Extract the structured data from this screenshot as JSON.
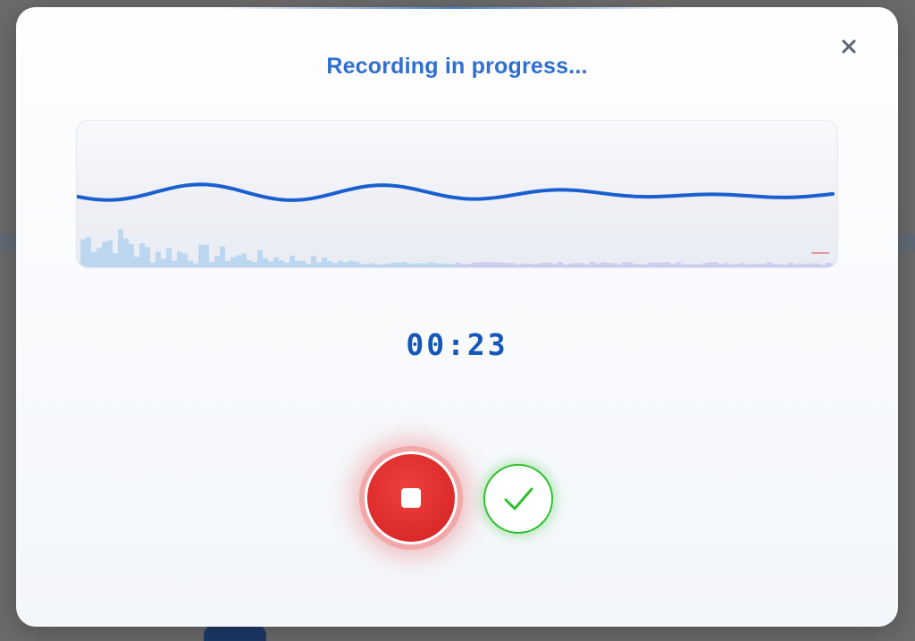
{
  "dialog": {
    "title": "Recording in progress...",
    "timer": "00:23"
  },
  "controls": {
    "close_icon": "close-icon",
    "stop_icon": "stop-icon",
    "confirm_icon": "checkmark-icon"
  },
  "colors": {
    "accent": "#2f6fd0",
    "timer": "#1557b8",
    "waveform": "#1a5fd0",
    "stop": "#dc2a2a",
    "confirm": "#2fbf2f"
  }
}
